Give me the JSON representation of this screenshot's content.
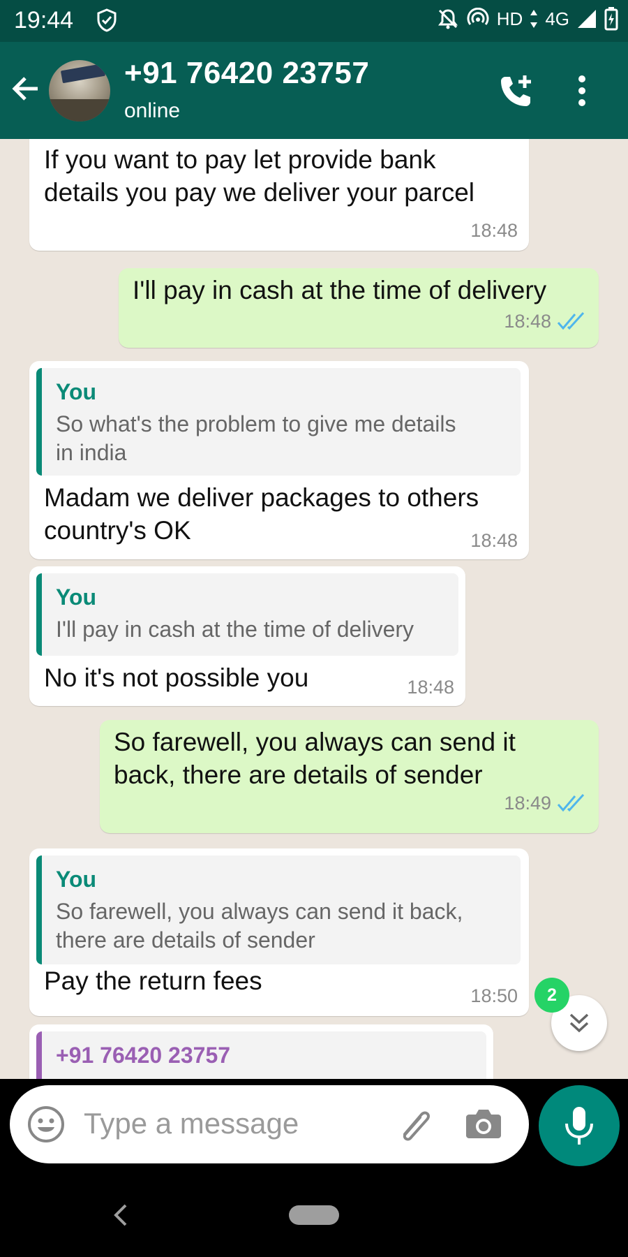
{
  "status_bar": {
    "time": "19:44",
    "network": "HD",
    "signal_type": "4G",
    "icons": [
      "shield-icon",
      "mute-icon",
      "hotspot-icon",
      "signal-icon",
      "battery-charging-icon"
    ]
  },
  "header": {
    "contact_name": "+91 76420 23757",
    "status": "online",
    "icons": [
      "back-arrow-icon",
      "add-call-icon",
      "more-vert-icon"
    ]
  },
  "messages": [
    {
      "direction": "in",
      "text": "If you want to pay let provide bank\ndetails you pay we deliver your parcel",
      "time": "18:48"
    },
    {
      "direction": "out",
      "text": "I'll pay in cash at the time of delivery",
      "time": "18:48",
      "ticks": "read"
    },
    {
      "direction": "in",
      "quote": {
        "author": "You",
        "text": "So what's the problem to give me details\nin india"
      },
      "text": "Madam we deliver packages to others\ncountry's OK",
      "time": "18:48"
    },
    {
      "direction": "in",
      "quote": {
        "author": "You",
        "text": "I'll pay in cash at the time of delivery"
      },
      "text": "No it's not possible you",
      "time": "18:48"
    },
    {
      "direction": "out",
      "text": "So farewell, you always can send it\nback, there are details of sender",
      "time": "18:49",
      "ticks": "read"
    },
    {
      "direction": "in",
      "quote": {
        "author": "You",
        "text": "So farewell, you always can send it back,\nthere are details of sender"
      },
      "text": "Pay the return fees",
      "time": "18:50"
    },
    {
      "direction": "in",
      "quote": {
        "author": "+91 76420 23757",
        "text": ""
      }
    }
  ],
  "scroll": {
    "unread_count": "2",
    "icon": "double-chevron-down-icon"
  },
  "composer": {
    "placeholder": "Type a message",
    "icons": [
      "emoji-icon",
      "attach-icon",
      "camera-icon",
      "mic-icon"
    ]
  },
  "colors": {
    "status_bar": "#054d44",
    "header": "#075e54",
    "chat_background": "#ece5dd",
    "outgoing_bubble": "#dcf8c6",
    "incoming_bubble": "#ffffff",
    "accent": "#0a8a77",
    "read_ticks": "#4fb6ec",
    "badge": "#25d366"
  }
}
